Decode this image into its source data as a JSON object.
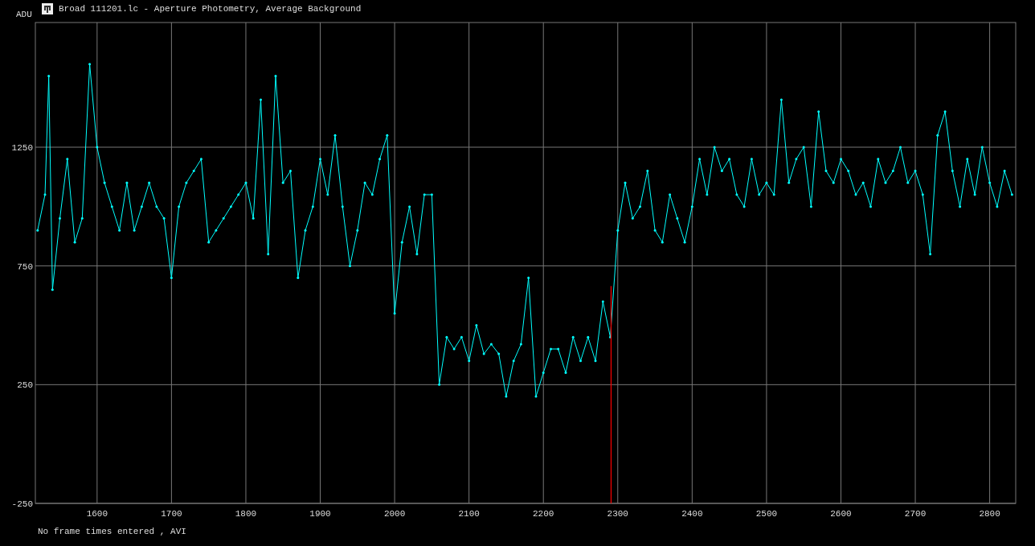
{
  "window": {
    "title": "Broad 111201.lc - Aperture Photometry, Average Background"
  },
  "chart": {
    "chart_data": {
      "type": "line",
      "ylabel": "ADU",
      "xlim": [
        1517,
        2835
      ],
      "ylim": [
        -250,
        1775
      ],
      "xticks": [
        1600,
        1700,
        1800,
        1900,
        2000,
        2100,
        2200,
        2300,
        2400,
        2500,
        2600,
        2700,
        2800
      ],
      "yticks": [
        -250,
        250,
        750,
        1250
      ],
      "x": [
        1520,
        1530,
        1535,
        1540,
        1550,
        1560,
        1570,
        1580,
        1590,
        1600,
        1610,
        1620,
        1630,
        1640,
        1650,
        1660,
        1670,
        1680,
        1690,
        1700,
        1710,
        1720,
        1730,
        1740,
        1750,
        1760,
        1770,
        1780,
        1790,
        1800,
        1810,
        1820,
        1830,
        1840,
        1850,
        1860,
        1870,
        1880,
        1890,
        1900,
        1910,
        1920,
        1930,
        1940,
        1950,
        1960,
        1970,
        1980,
        1990,
        2000,
        2010,
        2020,
        2030,
        2040,
        2050,
        2060,
        2070,
        2080,
        2090,
        2100,
        2110,
        2120,
        2130,
        2140,
        2150,
        2160,
        2170,
        2180,
        2190,
        2200,
        2210,
        2220,
        2230,
        2240,
        2250,
        2260,
        2270,
        2280,
        2290,
        2300,
        2310,
        2320,
        2330,
        2340,
        2350,
        2360,
        2370,
        2380,
        2390,
        2400,
        2410,
        2420,
        2430,
        2440,
        2450,
        2460,
        2470,
        2480,
        2490,
        2500,
        2510,
        2520,
        2530,
        2540,
        2550,
        2560,
        2570,
        2580,
        2590,
        2600,
        2610,
        2620,
        2630,
        2640,
        2650,
        2660,
        2670,
        2680,
        2690,
        2700,
        2710,
        2720,
        2730,
        2740,
        2750,
        2760,
        2770,
        2780,
        2790,
        2800,
        2810,
        2820,
        2830
      ],
      "series": [
        {
          "color": "#00ffff",
          "values": [
            900,
            1050,
            1550,
            650,
            950,
            1200,
            850,
            950,
            1600,
            1250,
            1100,
            1000,
            900,
            1100,
            900,
            1000,
            1100,
            1000,
            950,
            700,
            1000,
            1100,
            1150,
            1200,
            850,
            900,
            950,
            1000,
            1050,
            1100,
            950,
            1450,
            800,
            1550,
            1100,
            1150,
            700,
            900,
            1000,
            1200,
            1050,
            1300,
            1000,
            750,
            900,
            1100,
            1050,
            1200,
            1300,
            550,
            850,
            1000,
            800,
            1050,
            1050,
            250,
            450,
            400,
            450,
            350,
            500,
            380,
            420,
            380,
            200,
            350,
            420,
            700,
            200,
            300,
            400,
            400,
            300,
            450,
            350,
            450,
            350,
            600,
            450,
            900,
            1100,
            950,
            1000,
            1150,
            900,
            850,
            1050,
            950,
            850,
            1000,
            1200,
            1050,
            1250,
            1150,
            1200,
            1050,
            1000,
            1200,
            1050,
            1100,
            1050,
            1450,
            1100,
            1200,
            1250,
            1000,
            1400,
            1150,
            1100,
            1200,
            1150,
            1050,
            1100,
            1000,
            1200,
            1100,
            1150,
            1250,
            1100,
            1150,
            1050,
            800,
            1300,
            1400,
            1150,
            1000,
            1200,
            1050,
            1250,
            1100,
            1000,
            1150,
            1050
          ]
        }
      ],
      "grid": true,
      "ref_lines": [
        {
          "axis": "x",
          "value": 2291,
          "color": "#ff0000"
        }
      ]
    }
  },
  "status_bar": {
    "text": "No frame times entered , AVI"
  }
}
